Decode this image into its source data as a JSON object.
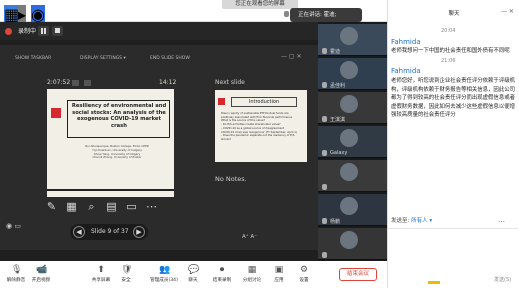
{
  "topbar": {
    "banner": "您正在观看您的屏幕",
    "talking": "正在讲话: 霍迪;"
  },
  "recording": {
    "label": "录制中"
  },
  "presenter_toolbar": {
    "show_taskbar": "SHOW TASKBAR",
    "display_settings": "DISPLAY SETTINGS ▾",
    "end_slide_show": "END SLIDE SHOW"
  },
  "presenter": {
    "elapsed": "2:07:52",
    "clock": "14:12",
    "next_label": "Next slide",
    "notes": "No Notes.",
    "slide_counter": "Slide 9 of 37",
    "font_size": "A⁺  A⁻"
  },
  "current_slide": {
    "title": "Resiliency of environmental and social stocks: An analysis of the exogenous COVID-19 market crash",
    "authors": "Rui Albuquerque, Boston College, ECGI, CEPR\nYrjo Koskinen, University of Calgary\nShuai Yang, University of Calgary\nChendi Zhang, University of Exeter"
  },
  "next_slide": {
    "title": "Introduction",
    "bullets": "Rise in equity of sustainable ETF/mutual funds are positively associated with firm financial performance\nWhat is the source of this value?\n- Do E/S activities create shareholder value?\n- COVID-19 as a global source of disagreement\nCOVID-19 crisis was 'exogenous' (FT September, April 1)\n- Does the pandemic separate out the resiliency of E/S stocks?"
  },
  "participants": [
    {
      "name": "霍迪"
    },
    {
      "name": "孟佳利"
    },
    {
      "name": "王淇淇"
    },
    {
      "name": "Galaxy"
    },
    {
      "name": ""
    },
    {
      "name": "杨鹏"
    },
    {
      "name": ""
    }
  ],
  "chat": {
    "title": "聊天",
    "time1": "20:04",
    "sender1": "Fahmida",
    "msg1": "老师我想问一下中国的社会责任和国外债有不同呢",
    "time2": "21:06",
    "sender2": "Fahmida",
    "msg2": "老师您好，听您说到企业社会责任评分依赖于评级机构，评级机构依赖于财务报告等相关信息，因此公司都为了得到较高的社会责任评分而出现虚假信息或者虚假财务数据，因此如何去减少这些虚假信息以便增强较高质量的社会责任评分",
    "send_to_label": "发送至:",
    "send_to_value": "所有人 ▾",
    "more": "…",
    "send_button": "发送(S)"
  },
  "bottombar": {
    "items": [
      {
        "label": "解除静音",
        "icon": "mic-icon"
      },
      {
        "label": "开启视频",
        "icon": "video-icon"
      },
      {
        "label": "共享屏幕",
        "icon": "share-icon"
      },
      {
        "label": "安全",
        "icon": "shield-icon"
      },
      {
        "label": "管理成员(34)",
        "icon": "people-icon"
      },
      {
        "label": "聊天",
        "icon": "chat-icon"
      },
      {
        "label": "结束录制",
        "icon": "record-icon"
      },
      {
        "label": "分组讨论",
        "icon": "breakout-icon"
      },
      {
        "label": "应用",
        "icon": "apps-icon"
      },
      {
        "label": "设置",
        "icon": "gear-icon"
      }
    ],
    "end_meeting": "结束会议"
  },
  "colors": {
    "accent": "#1e6fd0",
    "danger": "#e0453c",
    "slide_red": "#d8282f"
  }
}
